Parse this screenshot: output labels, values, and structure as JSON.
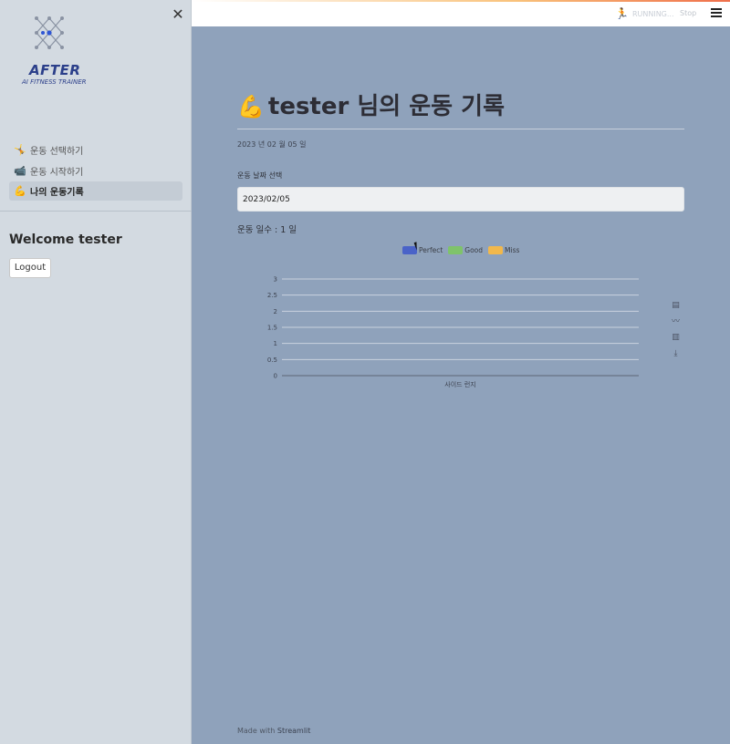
{
  "sidebar": {
    "close_icon": "close-icon",
    "logo": {
      "title": "AFTER",
      "subtitle": "AI FITNESS TRAINER",
      "color": "#2b3f8a"
    },
    "items": [
      {
        "label": "운동 선택하기",
        "icon": "🤸"
      },
      {
        "label": "운동 시작하기",
        "icon": "📹"
      },
      {
        "label": "나의 운동기록",
        "icon": "💪",
        "active": true
      }
    ],
    "welcome": "Welcome tester",
    "logout_label": "Logout"
  },
  "header": {
    "running_label": "RUNNING...",
    "stop_label": "Stop",
    "menu_icon": "hamburger-icon"
  },
  "main": {
    "title_icon": "💪",
    "title": "tester 님의 운동 기록",
    "date_text": "2023 년 02 월 05 일",
    "date_field_label": "운동 날짜 선택",
    "date_value": "2023/02/05",
    "days_text": "운동 일수 : 1 일",
    "footer_prefix": "Made with",
    "footer_link": "Streamlit"
  },
  "chart_data": {
    "type": "bar",
    "categories": [
      ""
    ],
    "series": [
      {
        "name": "Perfect",
        "values": [
          0
        ],
        "color": "#4a63c8"
      },
      {
        "name": "Good",
        "values": [
          0
        ],
        "color": "#7fc36a"
      },
      {
        "name": "Miss",
        "values": [
          0
        ],
        "color": "#f2b84b"
      }
    ],
    "xlabel": "사이드 런지",
    "ylabel": "",
    "ylim": [
      0,
      3
    ],
    "yticks": [
      "0",
      "0.5",
      "1",
      "1.5",
      "2",
      "2.5",
      "3"
    ],
    "legend": "top-center",
    "grid": true
  }
}
